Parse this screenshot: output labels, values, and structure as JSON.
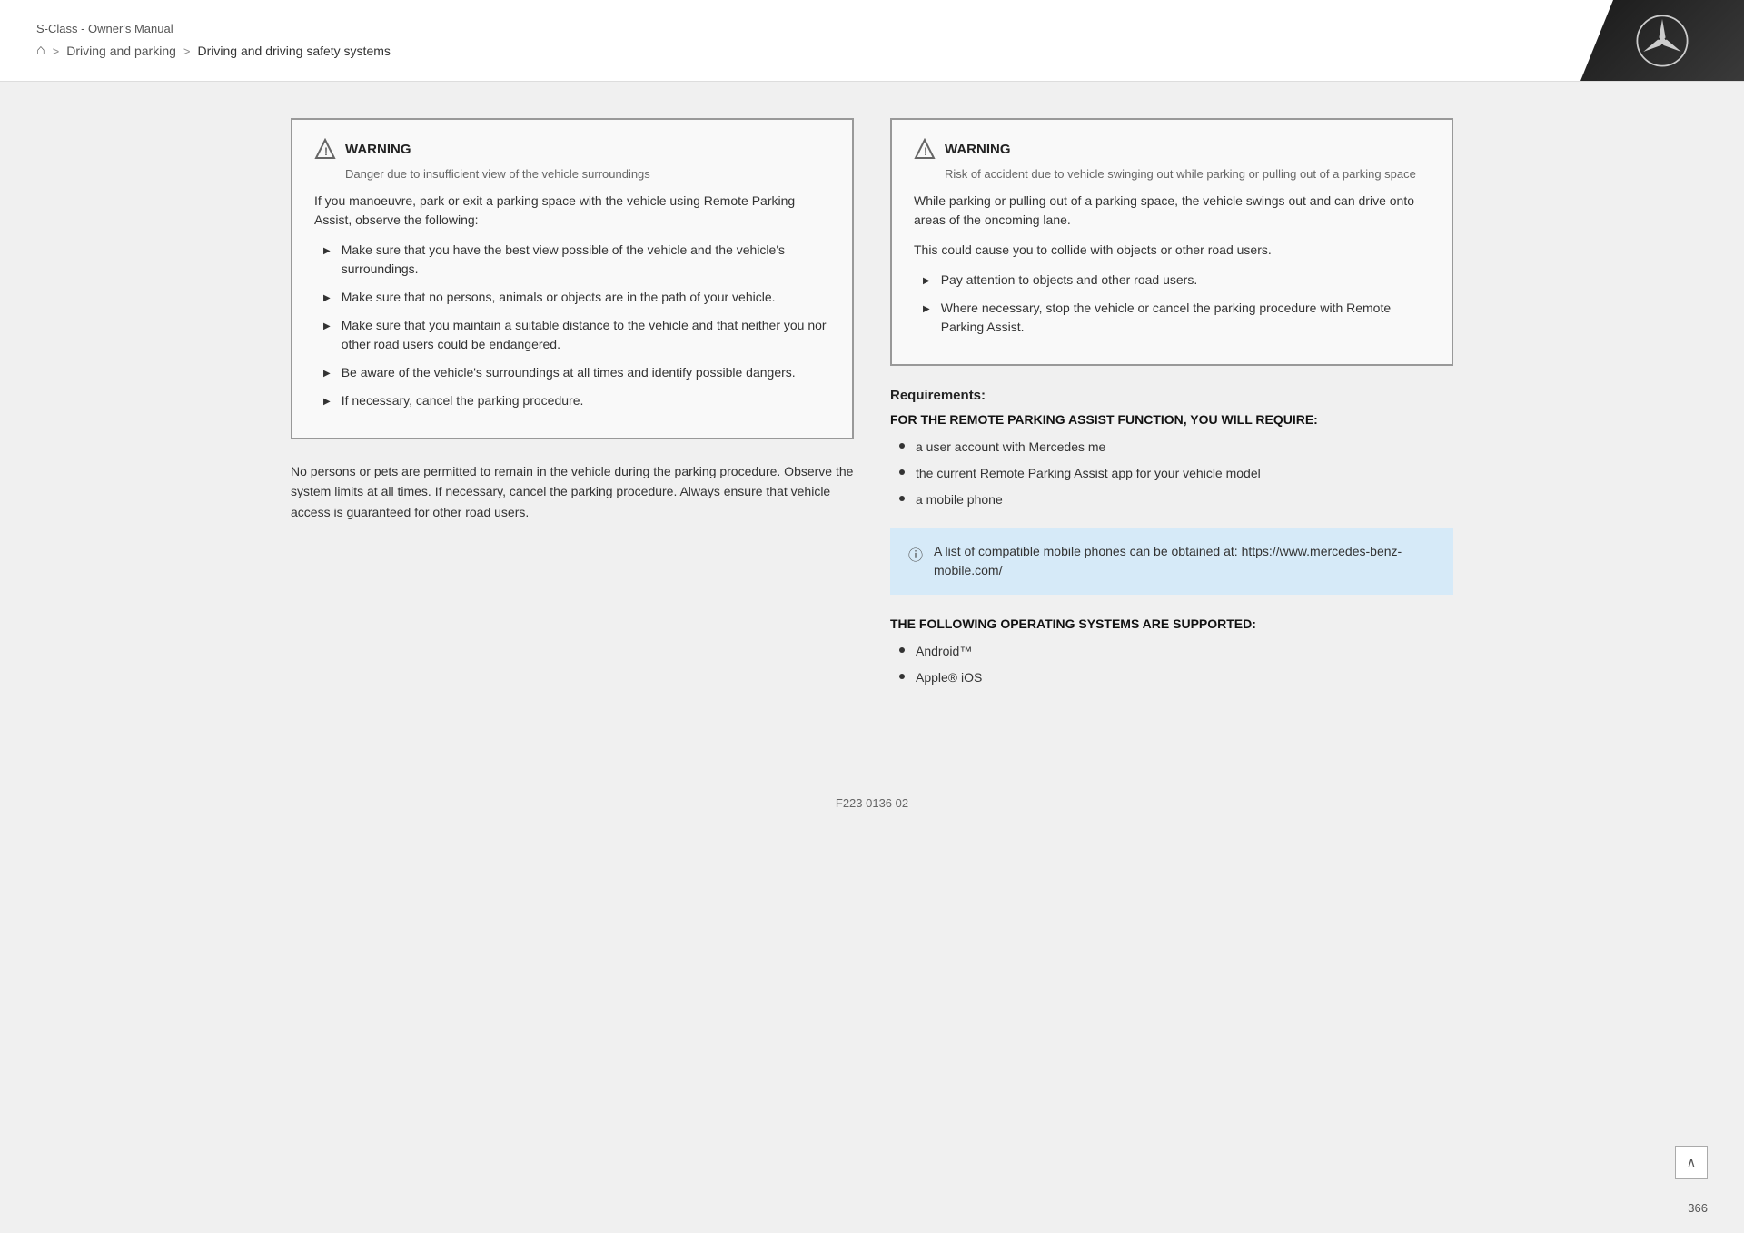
{
  "header": {
    "title": "S-Class - Owner's Manual",
    "breadcrumb": {
      "home_icon": "⌂",
      "sep1": ">",
      "section": "Driving and parking",
      "sep2": ">",
      "current": "Driving and driving safety systems"
    }
  },
  "logo": {
    "alt": "Mercedes-Benz Star"
  },
  "left_warning": {
    "title": "WARNING",
    "subtitle": "Danger due to insufficient view of the vehicle surroundings",
    "body": "If you manoeuvre, park or exit a parking space with the vehicle using Remote Parking Assist, observe the following:",
    "items": [
      "Make sure that you have the best view possible of the vehicle and the vehicle's surroundings.",
      "Make sure that no persons, animals or objects are in the path of your vehicle.",
      "Make sure that you maintain a suitable distance to the vehicle and that neither you nor other road users could be endangered.",
      "Be aware of the vehicle's surroundings at all times and identify possible dangers.",
      "If necessary, cancel the parking procedure."
    ]
  },
  "left_body": "No persons or pets are permitted to remain in the vehicle during the parking procedure. Observe the system limits at all times. If necessary, cancel the parking procedure. Always ensure that vehicle access is guaranteed for other road users.",
  "right_warning": {
    "title": "WARNING",
    "subtitle": "Risk of accident due to vehicle swinging out while parking or pulling out of a parking space",
    "body1": "While parking or pulling out of a parking space, the vehicle swings out and can drive onto areas of the oncoming lane.",
    "body2": "This could cause you to collide with objects or other road users.",
    "items": [
      "Pay attention to objects and other road users.",
      "Where necessary, stop the vehicle or cancel the parking procedure with Remote Parking Assist."
    ]
  },
  "requirements": {
    "label": "Requirements:",
    "heading": "FOR THE REMOTE PARKING ASSIST FUNCTION, YOU WILL REQUIRE:",
    "items": [
      "a user account with Mercedes me",
      "the current Remote Parking Assist app for your vehicle model",
      "a mobile phone"
    ]
  },
  "info_box": {
    "icon": "ⓘ",
    "text": "A list of compatible mobile phones can be obtained at: https://www.mercedes-benz-mobile.com/"
  },
  "os_section": {
    "heading": "THE FOLLOWING OPERATING SYSTEMS ARE SUPPORTED:",
    "items": [
      "Android™",
      "Apple® iOS"
    ]
  },
  "footer": {
    "code": "F223 0136 02"
  },
  "page_number": "366"
}
